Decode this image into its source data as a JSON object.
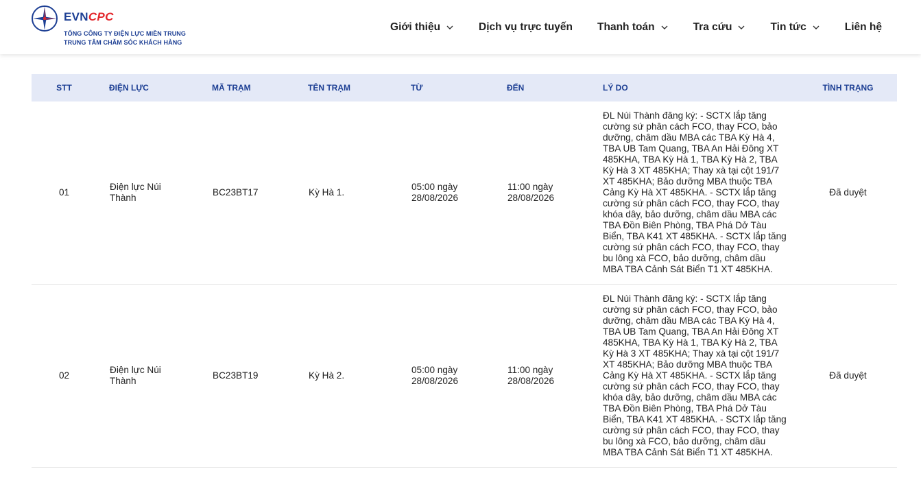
{
  "brand": {
    "word_evn": "EVN",
    "word_cpc": "CPC",
    "line1": "TỔNG CÔNG TY ĐIỆN LỰC MIỀN TRUNG",
    "line2": "TRUNG TÂM CHĂM SÓC KHÁCH HÀNG",
    "colors": {
      "blue": "#1d3f94",
      "red": "#e3262b"
    }
  },
  "nav": {
    "items": [
      {
        "label": "Giới thiệu",
        "has_dropdown": true
      },
      {
        "label": "Dịch vụ trực tuyến",
        "has_dropdown": false
      },
      {
        "label": "Thanh toán",
        "has_dropdown": true
      },
      {
        "label": "Tra cứu",
        "has_dropdown": true
      },
      {
        "label": "Tin tức",
        "has_dropdown": true
      },
      {
        "label": "Liên hệ",
        "has_dropdown": false
      }
    ]
  },
  "table": {
    "headers": {
      "stt": "STT",
      "dien_luc": "ĐIỆN LỰC",
      "ma_tram": "MÃ TRẠM",
      "ten_tram": "TÊN TRẠM",
      "tu": "TỪ",
      "den": "ĐẾN",
      "ly_do": "LÝ DO",
      "tinh_trang": "TÌNH TRẠNG"
    },
    "rows": [
      {
        "stt": "01",
        "dien_luc": "Điện lực Núi Thành",
        "ma_tram": "BC23BT17",
        "ten_tram": "Kỳ Hà 1.",
        "tu": "05:00 ngày 28/08/2026",
        "den": "11:00 ngày 28/08/2026",
        "ly_do": "ĐL Núi Thành đăng ký: - SCTX lắp tăng cường sứ phân cách FCO, thay FCO, bảo dưỡng, châm dầu MBA các TBA Kỳ Hà 4, TBA UB Tam Quang, TBA An Hải Đông XT 485KHA, TBA Kỳ Hà 1, TBA Kỳ Hà 2, TBA Kỳ Hà 3 XT 485KHA; Thay xà tại cột 191/7 XT 485KHA; Bảo dưỡng MBA thuộc TBA Cảng Kỳ Hà XT 485KHA. - SCTX lắp tăng cường sứ phân cách FCO, thay FCO, thay khóa dây, bảo dưỡng, châm dầu MBA các TBA Đồn Biên Phòng, TBA Phá Dở Tàu Biển, TBA K41 XT 485KHA. - SCTX lắp tăng cường sứ phân cách FCO, thay FCO, thay bu lông xà FCO, bảo dưỡng, châm dầu MBA TBA Cảnh Sát Biển T1 XT 485KHA.",
        "tinh_trang": "Đã duyệt"
      },
      {
        "stt": "02",
        "dien_luc": "Điện lực Núi Thành",
        "ma_tram": "BC23BT19",
        "ten_tram": "Kỳ Hà 2.",
        "tu": "05:00 ngày 28/08/2026",
        "den": "11:00 ngày 28/08/2026",
        "ly_do": "ĐL Núi Thành đăng ký: - SCTX lắp tăng cường sứ phân cách FCO, thay FCO, bảo dưỡng, châm dầu MBA các TBA Kỳ Hà 4, TBA UB Tam Quang, TBA An Hải Đông XT 485KHA, TBA Kỳ Hà 1, TBA Kỳ Hà 2, TBA Kỳ Hà 3 XT 485KHA; Thay xà tại cột 191/7 XT 485KHA; Bảo dưỡng MBA thuộc TBA Cảng Kỳ Hà XT 485KHA. - SCTX lắp tăng cường sứ phân cách FCO, thay FCO, thay khóa dây, bảo dưỡng, châm dầu MBA các TBA Đồn Biên Phòng, TBA Phá Dở Tàu Biển, TBA K41 XT 485KHA. - SCTX lắp tăng cường sứ phân cách FCO, thay FCO, thay bu lông xà FCO, bảo dưỡng, châm dầu MBA TBA Cảnh Sát Biển T1 XT 485KHA.",
        "tinh_trang": "Đã duyệt"
      }
    ]
  }
}
